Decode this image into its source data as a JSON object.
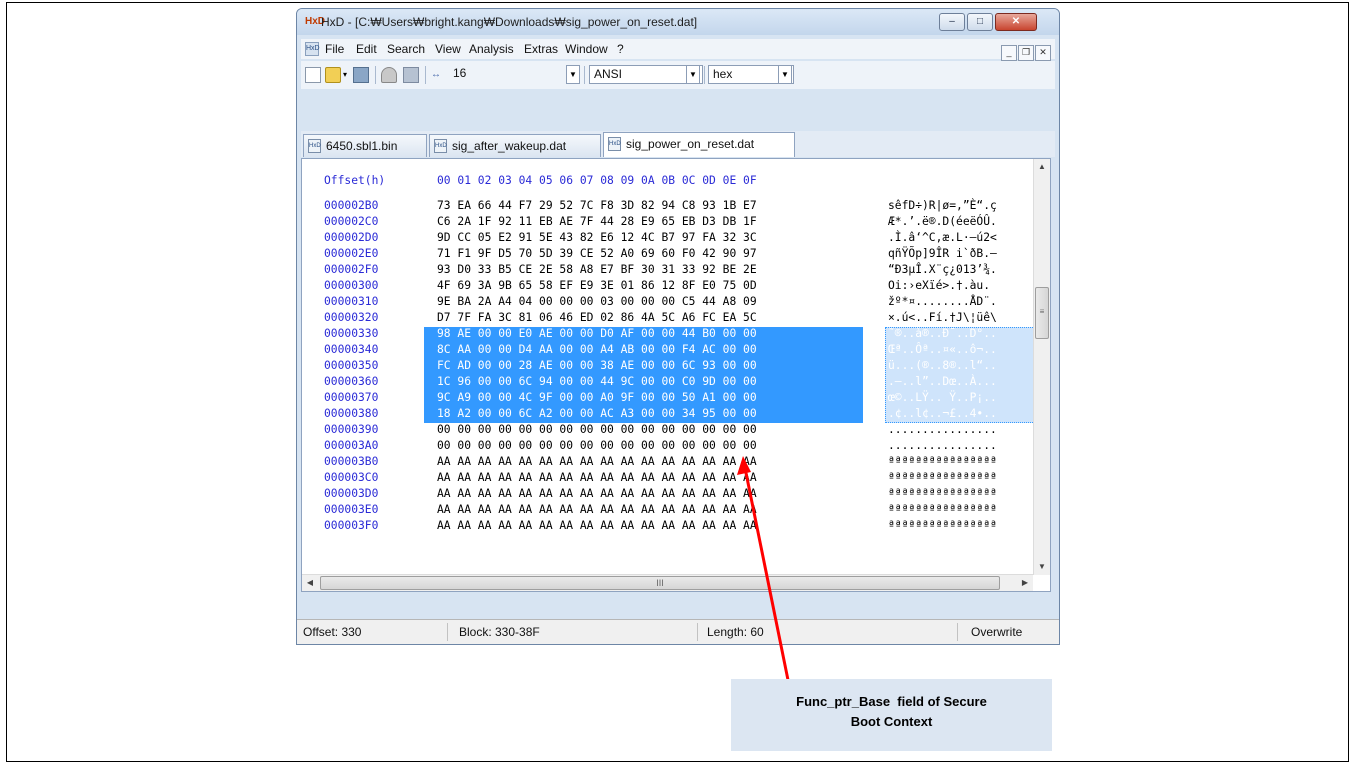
{
  "window": {
    "title": "HxD - [C:₩Users₩bright.kang₩Downloads₩sig_power_on_reset.dat]",
    "app_icon": "hxd-app-icon",
    "minimize_label": "–",
    "maximize_label": "□",
    "close_label": "✕"
  },
  "menu": {
    "items": [
      "File",
      "Edit",
      "Search",
      "View",
      "Analysis",
      "Extras",
      "Window",
      "?"
    ],
    "mdi_minimize": "_",
    "mdi_restore": "❐",
    "mdi_close": "✕"
  },
  "toolbar": {
    "bytes_per_row": "16",
    "charset": "ANSI",
    "offset_base": "hex"
  },
  "tabs": [
    "6450.sbl1.bin",
    "sig_after_wakeup.dat",
    "sig_power_on_reset.dat"
  ],
  "active_tab": 2,
  "hex_view": {
    "header_offset": "Offset(h)",
    "header_columns": "00 01 02 03 04 05 06 07 08 09 0A 0B 0C 0D 0E 0F",
    "rows": [
      {
        "offset": "000002B0",
        "bytes": "73 EA 66 44 F7 29 52 7C F8 3D 82 94 C8 93 1B E7",
        "ascii": "sêfD÷)R|ø=,”È“.ç"
      },
      {
        "offset": "000002C0",
        "bytes": "C6 2A 1F 92 11 EB AE 7F 44 28 E9 65 EB D3 DB 1F",
        "ascii": "Æ*.’.ë®.D(éeëÓÛ."
      },
      {
        "offset": "000002D0",
        "bytes": "9D CC 05 E2 91 5E 43 82 E6 12 4C B7 97 FA 32 3C",
        "ascii": ".Ì.â‘^C,æ.L·—ú2<"
      },
      {
        "offset": "000002E0",
        "bytes": "71 F1 9F D5 70 5D 39 CE 52 A0 69 60 F0 42 90 97",
        "ascii": "qñŸÕp]9ÎR i`ðB.—"
      },
      {
        "offset": "000002F0",
        "bytes": "93 D0 33 B5 CE 2E 58 A8 E7 BF 30 31 33 92 BE 2E",
        "ascii": "“Ð3µÎ.X¨ç¿013’¾."
      },
      {
        "offset": "00000300",
        "bytes": "4F 69 3A 9B 65 58 EF E9 3E 01 86 12 8F E0 75 0D",
        "ascii": "Oi:›eXïé>.†.àu."
      },
      {
        "offset": "00000310",
        "bytes": "9E BA 2A A4 04 00 00 00 03 00 00 00 C5 44 A8 09",
        "ascii": "žº*¤........ÅD¨."
      },
      {
        "offset": "00000320",
        "bytes": "D7 7F FA 3C 81 06 46 ED 02 86 4A 5C A6 FC EA 5C",
        "ascii": "×.ú<..Fí.†J\\¦üê\\"
      },
      {
        "offset": "00000330",
        "bytes": "98 AE 00 00 E0 AE 00 00 D0 AF 00 00 44 B0 00 00",
        "ascii": "˜®..à®..Ð¯..D°..",
        "selected": true
      },
      {
        "offset": "00000340",
        "bytes": "8C AA 00 00 D4 AA 00 00 A4 AB 00 00 F4 AC 00 00",
        "ascii": "Œª..Ôª..¤«..ô¬..",
        "selected": true
      },
      {
        "offset": "00000350",
        "bytes": "FC AD 00 00 28 AE 00 00 38 AE 00 00 6C 93 00 00",
        "ascii": "ü...(®..8®..l“..",
        "selected": true
      },
      {
        "offset": "00000360",
        "bytes": "1C 96 00 00 6C 94 00 00 44 9C 00 00 C0 9D 00 00",
        "ascii": ".–..l”..Dœ..À...",
        "selected": true
      },
      {
        "offset": "00000370",
        "bytes": "9C A9 00 00 4C 9F 00 00 A0 9F 00 00 50 A1 00 00",
        "ascii": "œ©..LŸ.. Ÿ..P¡..",
        "selected": true
      },
      {
        "offset": "00000380",
        "bytes": "18 A2 00 00 6C A2 00 00 AC A3 00 00 34 95 00 00",
        "ascii": ".¢..l¢..¬£..4•..",
        "selected": true
      },
      {
        "offset": "00000390",
        "bytes": "00 00 00 00 00 00 00 00 00 00 00 00 00 00 00 00",
        "ascii": "................"
      },
      {
        "offset": "000003A0",
        "bytes": "00 00 00 00 00 00 00 00 00 00 00 00 00 00 00 00",
        "ascii": "................"
      },
      {
        "offset": "000003B0",
        "bytes": "AA AA AA AA AA AA AA AA AA AA AA AA AA AA AA AA",
        "ascii": "ªªªªªªªªªªªªªªªª"
      },
      {
        "offset": "000003C0",
        "bytes": "AA AA AA AA AA AA AA AA AA AA AA AA AA AA AA AA",
        "ascii": "ªªªªªªªªªªªªªªªª"
      },
      {
        "offset": "000003D0",
        "bytes": "AA AA AA AA AA AA AA AA AA AA AA AA AA AA AA AA",
        "ascii": "ªªªªªªªªªªªªªªªª"
      },
      {
        "offset": "000003E0",
        "bytes": "AA AA AA AA AA AA AA AA AA AA AA AA AA AA AA AA",
        "ascii": "ªªªªªªªªªªªªªªªª"
      },
      {
        "offset": "000003F0",
        "bytes": "AA AA AA AA AA AA AA AA AA AA AA AA AA AA AA AA",
        "ascii": "ªªªªªªªªªªªªªªªª"
      }
    ],
    "hscroll_mark": "III"
  },
  "status": {
    "offset": "Offset: 330",
    "block": "Block: 330-38F",
    "length": "Length: 60",
    "mode": "Overwrite"
  },
  "callout": {
    "line1": "Func_ptr_Base  field of Secure",
    "line2": "Boot Context"
  },
  "colors": {
    "selection": "#3399ff",
    "offset_text": "#2a2ad6",
    "arrow": "#ff0000",
    "callout_bg": "#dce6f2"
  }
}
